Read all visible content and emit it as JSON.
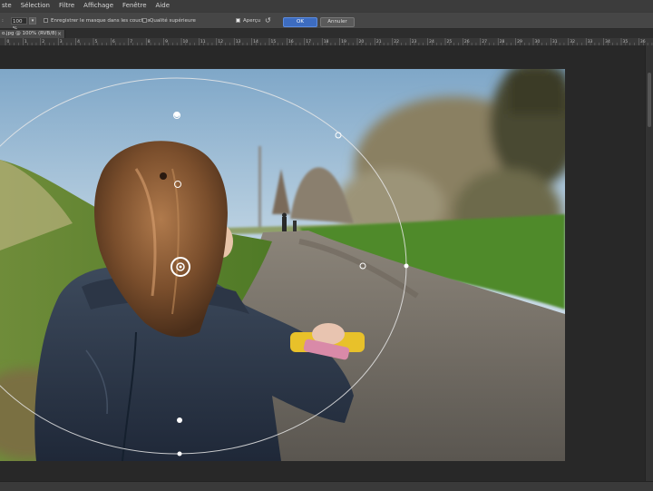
{
  "menubar": {
    "items": [
      "ste",
      "Sélection",
      "Filtre",
      "Affichage",
      "Fenêtre",
      "Aide"
    ]
  },
  "options": {
    "zoom_value": "100 %",
    "save_mask_label": "Enregistrer le masque dans les couches",
    "high_quality_label": "Qualité supérieure",
    "preview_label": "Aperçu",
    "preview_checked": true,
    "ok_label": "OK",
    "cancel_label": "Annuler"
  },
  "document": {
    "tab_title": "o.jpg @ 100% (RVB/8)"
  },
  "ruler": {
    "labels": [
      "0",
      "1",
      "2",
      "3",
      "4",
      "5",
      "6",
      "7",
      "8",
      "9",
      "10",
      "11",
      "12",
      "13",
      "14",
      "15",
      "16",
      "17",
      "18",
      "19",
      "20",
      "21",
      "22",
      "23",
      "24",
      "25",
      "26",
      "27",
      "28",
      "29",
      "30",
      "31",
      "32",
      "33",
      "34",
      "35",
      "36",
      "37"
    ]
  },
  "colors": {
    "ok_button": "#3d6cc0",
    "workspace": "#282828"
  }
}
